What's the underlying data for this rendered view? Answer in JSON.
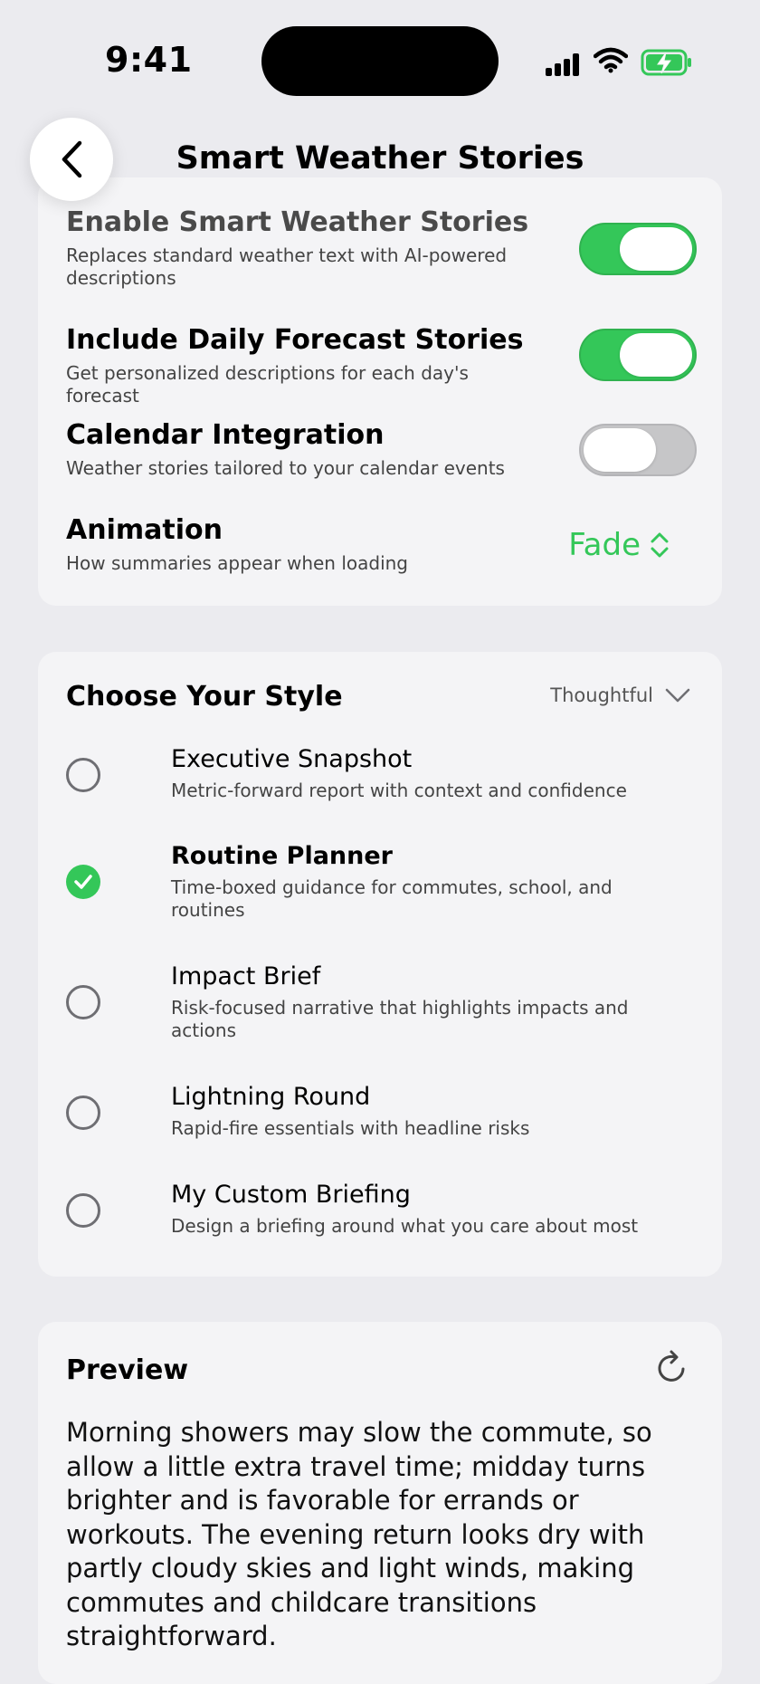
{
  "status_bar": {
    "time": "9:41"
  },
  "nav": {
    "title": "Smart Weather Stories"
  },
  "settings": [
    {
      "title": "Enable Smart Weather Stories",
      "subtitle": "Replaces standard weather text with AI-powered descriptions",
      "enabled": true
    },
    {
      "title": "Include Daily Forecast Stories",
      "subtitle": "Get personalized descriptions for each day's forecast",
      "enabled": true
    },
    {
      "title": "Calendar Integration",
      "subtitle": "Weather stories tailored to your calendar events",
      "enabled": false
    }
  ],
  "animation": {
    "title": "Animation",
    "subtitle": "How summaries appear when loading",
    "value": "Fade"
  },
  "style_section": {
    "title": "Choose Your Style",
    "dropdown_value": "Thoughtful",
    "options": [
      {
        "title": "Executive Snapshot",
        "subtitle": "Metric-forward report with context and confidence",
        "selected": false
      },
      {
        "title": "Routine Planner",
        "subtitle": "Time-boxed guidance for commutes, school, and routines",
        "selected": true
      },
      {
        "title": "Impact Brief",
        "subtitle": "Risk-focused narrative that highlights impacts and actions",
        "selected": false
      },
      {
        "title": "Lightning Round",
        "subtitle": "Rapid-fire essentials with headline risks",
        "selected": false
      },
      {
        "title": "My Custom Briefing",
        "subtitle": "Design a briefing around what you care about most",
        "selected": false
      }
    ]
  },
  "preview": {
    "title": "Preview",
    "text": "Morning showers may slow the commute, so allow a little extra travel time; midday turns brighter and is favorable for errands or workouts. The evening return looks dry with partly cloudy skies and light winds, making commutes and childcare transitions straightforward."
  },
  "colors": {
    "accent": "#34c759",
    "background": "#ebebef",
    "card": "#f4f4f6"
  },
  "icons": [
    "signal-icon",
    "wifi-icon",
    "battery-charging-icon",
    "chevron-left-icon",
    "chevron-up-down-icon",
    "chevron-down-icon",
    "checkmark-icon",
    "refresh-icon"
  ]
}
